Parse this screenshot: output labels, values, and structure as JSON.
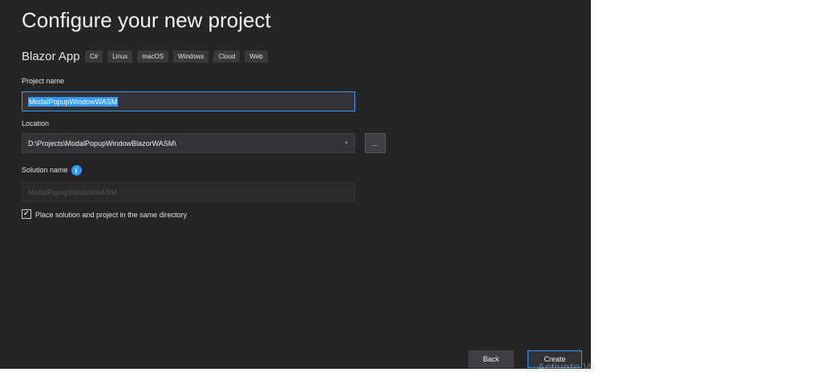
{
  "title": "Configure your new project",
  "template": {
    "name": "Blazor App",
    "tags": [
      "C#",
      "Linux",
      "macOS",
      "Windows",
      "Cloud",
      "Web"
    ]
  },
  "project_name": {
    "label": "Project name",
    "value": "ModalPopupWindowWASM"
  },
  "location": {
    "label": "Location",
    "value": "D:\\Projects\\ModalPopupWindowBlazorWASM\\",
    "browse": "..."
  },
  "solution_name": {
    "label": "Solution name",
    "info": "i",
    "value": "ModalPopupWindowWASM"
  },
  "same_dir": {
    "label": "Place solution and project in the same directory",
    "checked": true,
    "mark": "✓"
  },
  "buttons": {
    "back": "Back",
    "create": "Create"
  },
  "watermark": "Activate W"
}
